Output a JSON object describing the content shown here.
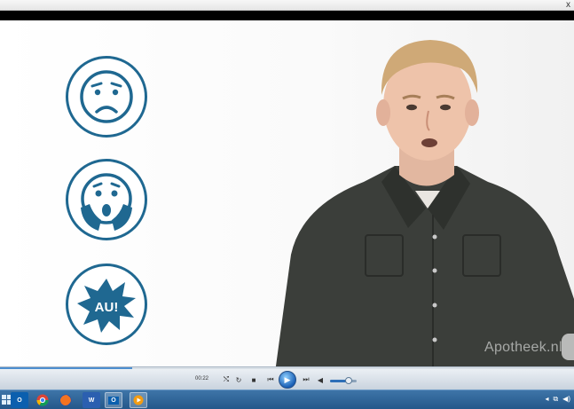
{
  "window": {
    "close_glyph": "x"
  },
  "icons": [
    {
      "name": "worried-face-icon"
    },
    {
      "name": "scared-face-icon"
    },
    {
      "name": "pain-burst-icon",
      "text": "AU!"
    }
  ],
  "colors": {
    "icon_blue": "#1f6891",
    "taskbar": "#2e6698",
    "play_button": "#1a5fb5"
  },
  "video": {
    "watermark": "Apotheek.nl"
  },
  "player": {
    "time": "00:22",
    "buttons": [
      "shuffle",
      "repeat",
      "stop",
      "previous",
      "play",
      "next",
      "mute"
    ],
    "volume": 0.7,
    "progress": 0.23
  },
  "taskbar": {
    "apps": [
      {
        "name": "outlook-icon",
        "label": "O⁠"
      },
      {
        "name": "chrome-icon",
        "label": ""
      },
      {
        "name": "firefox-icon",
        "label": ""
      },
      {
        "name": "word-icon",
        "label": "W"
      },
      {
        "name": "outlook-active-icon",
        "label": "O"
      },
      {
        "name": "media-player-icon",
        "label": ""
      }
    ]
  }
}
